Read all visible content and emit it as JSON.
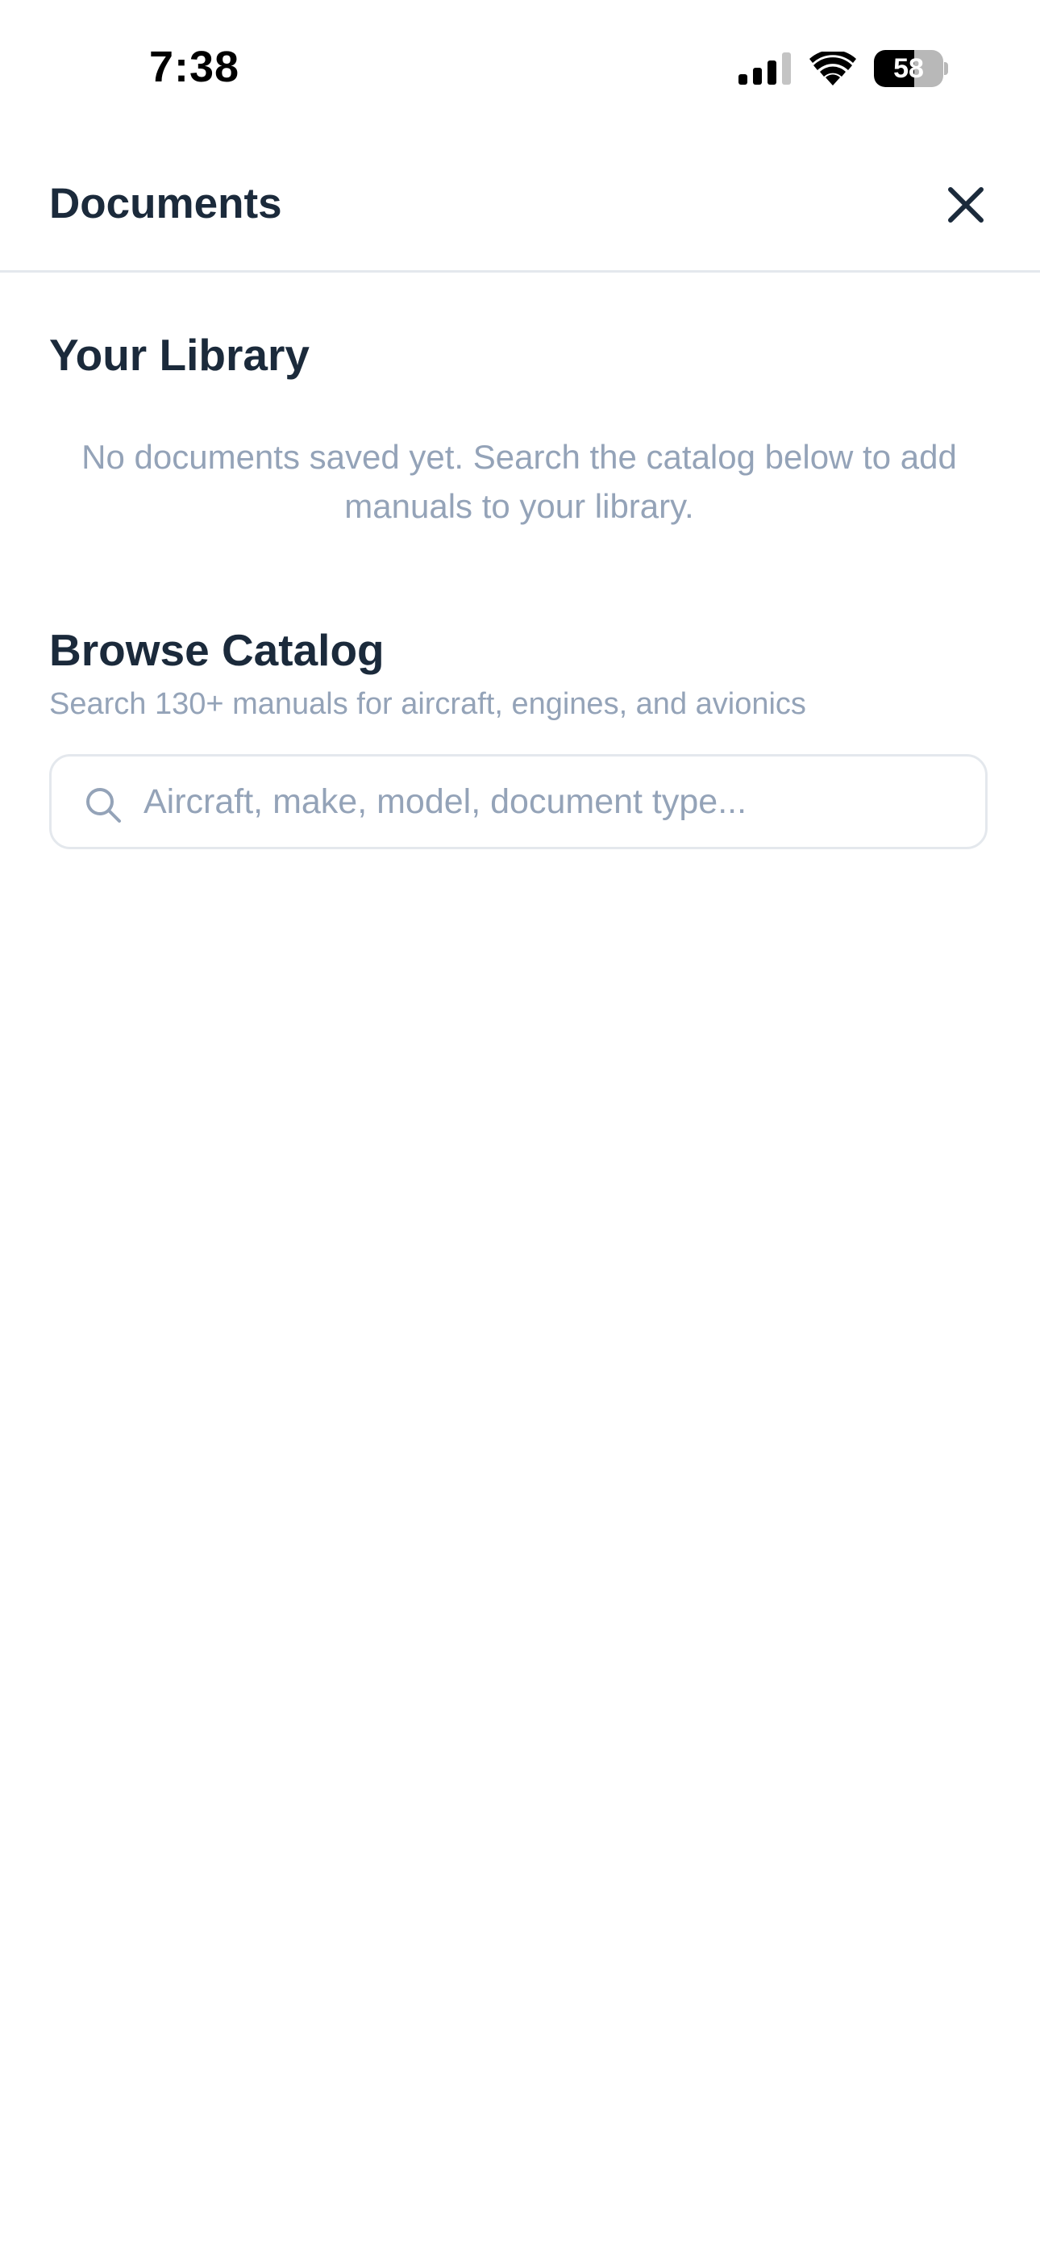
{
  "status_bar": {
    "time": "7:38",
    "battery_level": "58",
    "battery_fraction": 0.58,
    "icons": [
      "cellular-signal-icon",
      "wifi-icon",
      "battery-icon"
    ]
  },
  "header": {
    "title": "Documents",
    "close_icon": "close-icon"
  },
  "library": {
    "title": "Your Library",
    "empty_message": "No documents saved yet. Search the catalog below to add manuals to your library."
  },
  "catalog": {
    "title": "Browse Catalog",
    "subtitle": "Search 130+ manuals for aircraft, engines, and avionics",
    "search": {
      "icon": "search-icon",
      "value": "",
      "placeholder": "Aircraft, make, model, document type..."
    }
  },
  "colors": {
    "heading": "#1b2a3b",
    "muted_text": "#94a3b8",
    "border": "#e4e8ed",
    "background": "#ffffff"
  }
}
